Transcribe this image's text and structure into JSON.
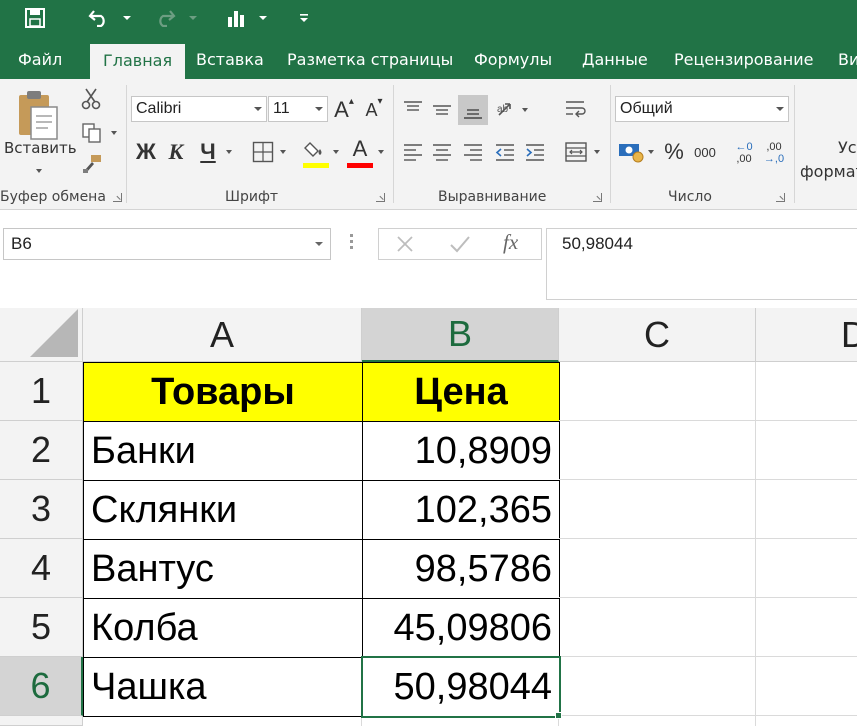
{
  "tabs": [
    {
      "id": "file",
      "label": "Файл"
    },
    {
      "id": "home",
      "label": "Главная"
    },
    {
      "id": "insert",
      "label": "Вставка"
    },
    {
      "id": "layout",
      "label": "Разметка страницы"
    },
    {
      "id": "formulas",
      "label": "Формулы"
    },
    {
      "id": "data",
      "label": "Данные"
    },
    {
      "id": "review",
      "label": "Рецензирование"
    },
    {
      "id": "view",
      "label": "Ви"
    }
  ],
  "ribbon": {
    "clipboard": {
      "paste_label": "Вставить",
      "group_label": "Буфер обмена"
    },
    "font": {
      "name": "Calibri",
      "size": "11",
      "bold": "Ж",
      "italic": "К",
      "underline": "Ч",
      "grow": "A",
      "shrink": "A",
      "color_letter": "A",
      "group_label": "Шрифт",
      "highlight_color": "#ffff00",
      "font_color": "#ff0000"
    },
    "alignment": {
      "group_label": "Выравнивание"
    },
    "number": {
      "format": "Общий",
      "percent": "%",
      "thousands": "000",
      "inc_dec_top": "←0",
      "inc_dec_bottom": ",00",
      "dec_dec_top": ",00",
      "dec_dec_bottom": "→,0",
      "group_label": "Число"
    },
    "styles": {
      "line1": "Ус",
      "line2": "формат"
    }
  },
  "formula_bar": {
    "name_box": "B6",
    "fx": "fx",
    "value": "50,98044"
  },
  "grid": {
    "columns": [
      "A",
      "B",
      "C",
      "D"
    ],
    "rows": [
      "1",
      "2",
      "3",
      "4",
      "5",
      "6"
    ],
    "header": {
      "a": "Товары",
      "b": "Цена"
    },
    "data": [
      {
        "name": "Банки",
        "price": "10,8909"
      },
      {
        "name": "Склянки",
        "price": "102,365"
      },
      {
        "name": "Вантус",
        "price": "98,5786"
      },
      {
        "name": "Колба",
        "price": "45,09806"
      },
      {
        "name": "Чашка",
        "price": "50,98044"
      }
    ],
    "active_cell": "B6",
    "header_fill": "#ffff00",
    "accent": "#217346"
  }
}
